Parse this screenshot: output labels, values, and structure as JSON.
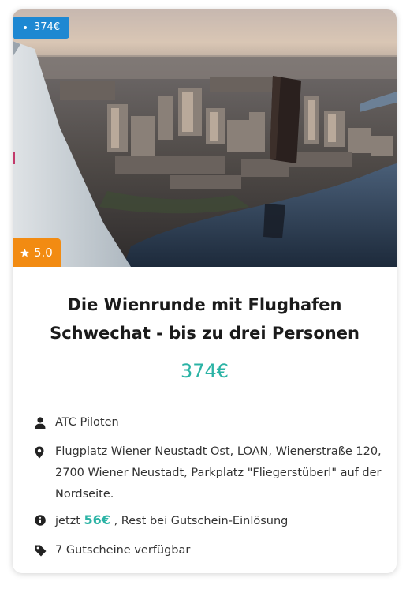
{
  "product": {
    "price_tag": "374€",
    "rating": "5.0",
    "title": "Die Wienrunde mit Flughafen Schwechat - bis zu drei Personen",
    "price": "374€"
  },
  "details": {
    "provider": "ATC Piloten",
    "location": "Flugplatz Wiener Neustadt Ost, LOAN, Wienerstraße 120, 2700 Wiener Neustadt, Parkplatz \"Fliegerstüberl\" auf der Nordseite.",
    "payment_prefix": "jetzt",
    "payment_amount": "56€",
    "payment_suffix": ", Rest bei Gutschein-Einlösung",
    "vouchers": "7 Gutscheine verfügbar"
  },
  "icons": {
    "price_tag": "tag-badge",
    "rating": "star-icon",
    "provider": "user-icon",
    "location": "map-marker-icon",
    "payment": "info-circle-icon",
    "vouchers": "tag-icon"
  },
  "colors": {
    "price_tag": "#1e88d2",
    "rating": "#f28b12",
    "accent": "#2bb3a5"
  }
}
